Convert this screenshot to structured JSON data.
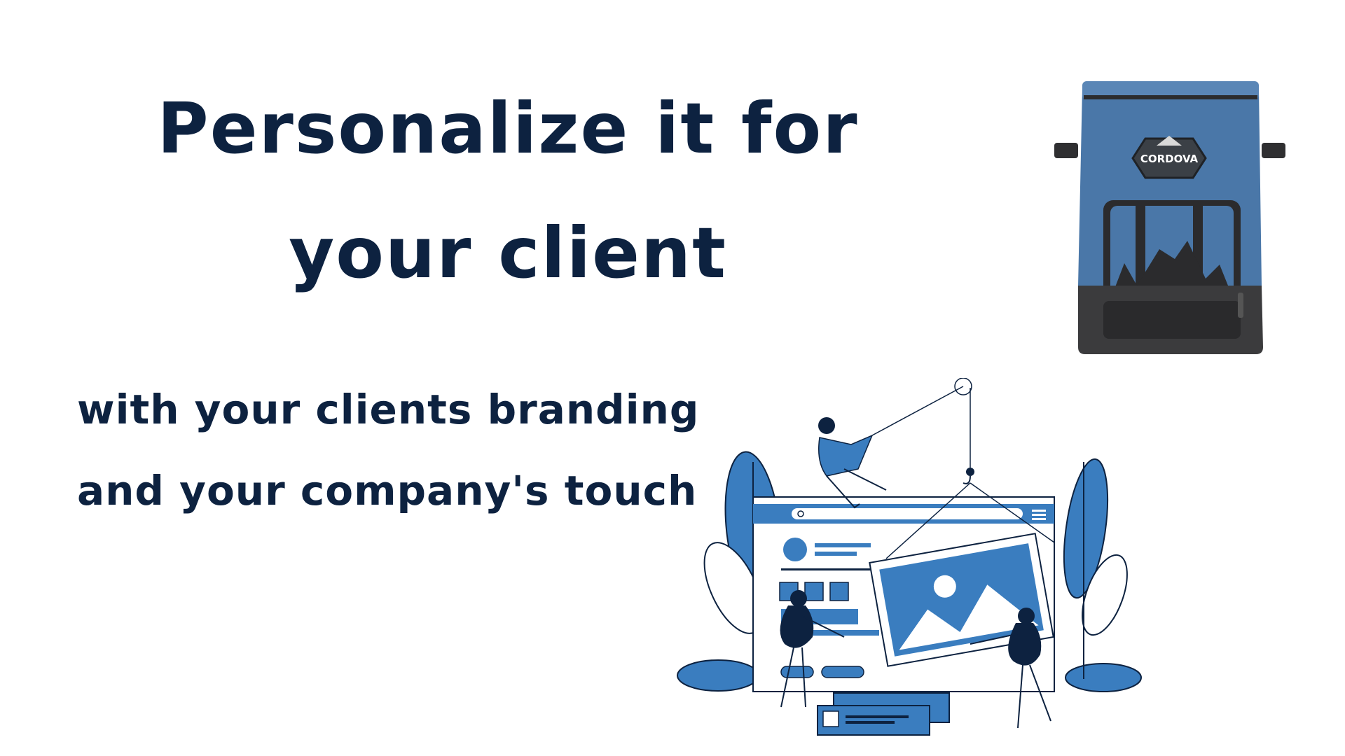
{
  "headline": {
    "line1": "Personalize it for",
    "line2": "your client"
  },
  "subheadline": {
    "line1": "with your clients branding",
    "line2": "and your company's touch"
  },
  "product": {
    "brand_label": "CORDOVA",
    "icon": "backpack-cooler-image"
  },
  "illustration": {
    "icon": "web-design-team-illustration"
  },
  "colors": {
    "text": "#0d2240",
    "accent_blue": "#3a7dbf",
    "bag_blue": "#4a77a8",
    "bag_dark": "#3b3b3d",
    "background": "#ffffff"
  }
}
